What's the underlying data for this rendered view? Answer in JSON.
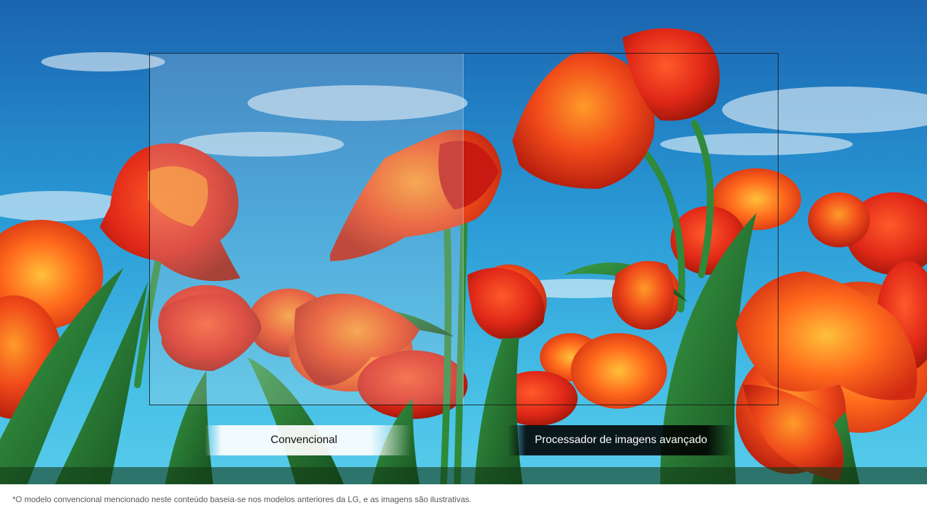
{
  "image": {
    "subject": "red-orange parrot tulips against blue sky with clouds",
    "colors": {
      "sky_top": "#1e6fb8",
      "sky_mid": "#2b9fd8",
      "sky_low": "#4cc3e8",
      "petal_red": "#e0321a",
      "petal_orange": "#ff7a1a",
      "petal_yellow": "#ffb020",
      "stem_green": "#2f8a3a",
      "leaf_dark": "#1f5e2a"
    }
  },
  "comparison": {
    "left_label": "Convencional",
    "right_label": "Processador de imagens avançado"
  },
  "footnote": "*O modelo convencional mencionado neste conteúdo baseia-se nos modelos anteriores da LG, e as imagens são ilustrativas."
}
